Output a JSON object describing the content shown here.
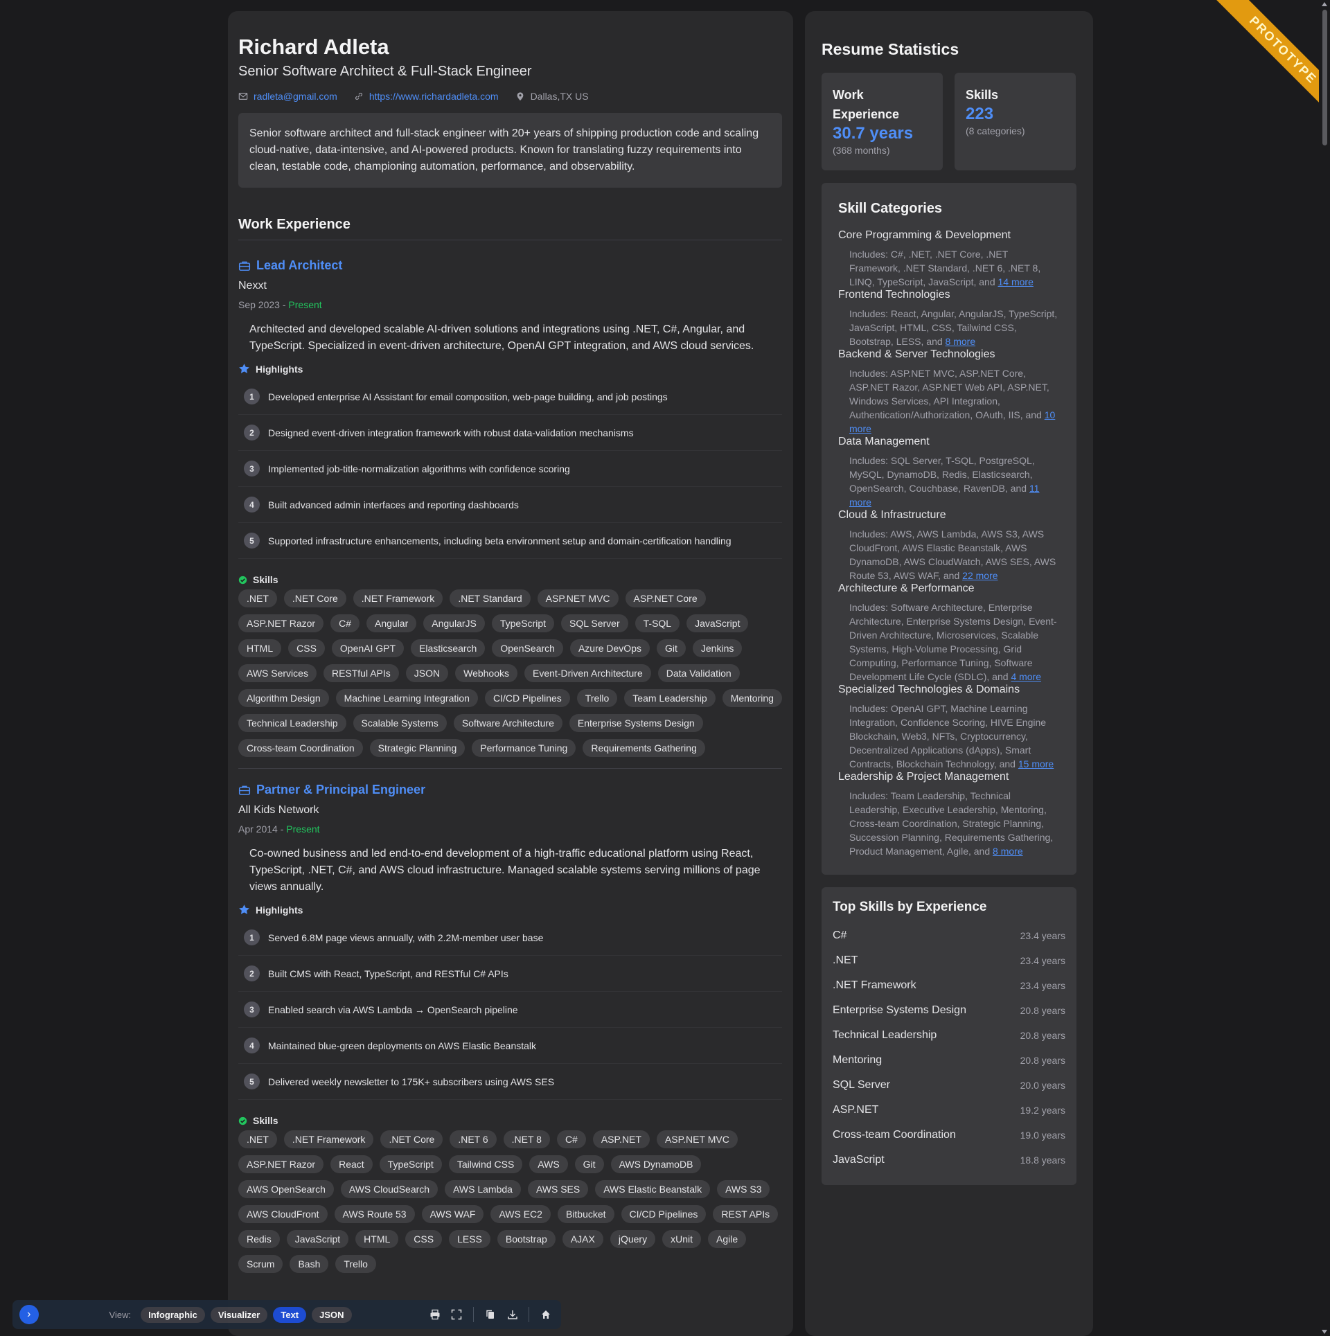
{
  "profile": {
    "name": "Richard Adleta",
    "title": "Senior Software Architect & Full-Stack Engineer",
    "email": "radleta@gmail.com",
    "website": "https://www.richardadleta.com",
    "location": "Dallas,TX  US",
    "summary": "Senior software architect and full-stack engineer with 20+ years of shipping production code and scaling cloud-native, data-intensive, and AI-powered products. Known for translating fuzzy requirements into clean, testable code, championing automation, performance, and observability."
  },
  "work": {
    "heading": "Work Experience",
    "highlights_label": "Highlights",
    "skills_label": "Skills",
    "jobs": [
      {
        "title": "Lead Architect",
        "company": "Nexxt",
        "start": "Sep 2023",
        "sep": " - ",
        "end": "Present",
        "description": "Architected and developed scalable AI-driven solutions and integrations using .NET, C#, Angular, and TypeScript. Specialized in event-driven architecture, OpenAI GPT integration, and AWS cloud services.",
        "highlights": [
          "Developed enterprise AI Assistant for email composition, web-page building, and job postings",
          "Designed event-driven integration framework with robust data-validation mechanisms",
          "Implemented job-title-normalization algorithms with confidence scoring",
          "Built advanced admin interfaces and reporting dashboards",
          "Supported infrastructure enhancements, including beta environment setup and domain-certification handling"
        ],
        "skills": [
          ".NET",
          ".NET Core",
          ".NET Framework",
          ".NET Standard",
          "ASP.NET MVC",
          "ASP.NET Core",
          "ASP.NET Razor",
          "C#",
          "Angular",
          "AngularJS",
          "TypeScript",
          "SQL Server",
          "T-SQL",
          "JavaScript",
          "HTML",
          "CSS",
          "OpenAI GPT",
          "Elasticsearch",
          "OpenSearch",
          "Azure DevOps",
          "Git",
          "Jenkins",
          "AWS Services",
          "RESTful APIs",
          "JSON",
          "Webhooks",
          "Event-Driven Architecture",
          "Data Validation",
          "Algorithm Design",
          "Machine Learning Integration",
          "CI/CD Pipelines",
          "Trello",
          "Team Leadership",
          "Mentoring",
          "Technical Leadership",
          "Scalable Systems",
          "Software Architecture",
          "Enterprise Systems Design",
          "Cross-team Coordination",
          "Strategic Planning",
          "Performance Tuning",
          "Requirements Gathering"
        ]
      },
      {
        "title": "Partner & Principal Engineer",
        "company": "All Kids Network",
        "start": "Apr 2014",
        "sep": " - ",
        "end": "Present",
        "description": "Co-owned business and led end-to-end development of a high-traffic educational platform using React, TypeScript, .NET, C#, and AWS cloud infrastructure. Managed scalable systems serving millions of page views annually.",
        "highlights": [
          "Served 6.8M page views annually, with 2.2M-member user base",
          "Built CMS with React, TypeScript, and RESTful C# APIs",
          "Enabled search via AWS Lambda → OpenSearch pipeline",
          "Maintained blue-green deployments on AWS Elastic Beanstalk",
          "Delivered weekly newsletter to 175K+ subscribers using AWS SES"
        ],
        "skills": [
          ".NET",
          ".NET Framework",
          ".NET Core",
          ".NET 6",
          ".NET 8",
          "C#",
          "ASP.NET",
          "ASP.NET MVC",
          "ASP.NET Razor",
          "React",
          "TypeScript",
          "Tailwind CSS",
          "AWS",
          "Git",
          "AWS DynamoDB",
          "AWS OpenSearch",
          "AWS CloudSearch",
          "AWS Lambda",
          "AWS SES",
          "AWS Elastic Beanstalk",
          "AWS S3",
          "AWS CloudFront",
          "AWS Route 53",
          "AWS WAF",
          "AWS EC2",
          "Bitbucket",
          "CI/CD Pipelines",
          "REST APIs",
          "Redis",
          "JavaScript",
          "HTML",
          "CSS",
          "LESS",
          "Bootstrap",
          "AJAX",
          "jQuery",
          "xUnit",
          "Agile",
          "Scrum",
          "Bash",
          "Trello"
        ]
      }
    ]
  },
  "stats": {
    "heading": "Resume Statistics",
    "work_label": "Work Experience",
    "work_value": "30.7 years",
    "work_note": "(368 months)",
    "skills_label": "Skills",
    "skills_value": "223",
    "skills_note": "(8 categories)"
  },
  "categories": {
    "heading": "Skill Categories",
    "items": [
      {
        "name": "Core Programming & Development",
        "includes": "Includes: C#, .NET, .NET Core, .NET Framework, .NET Standard, .NET 6, .NET 8, LINQ, TypeScript, JavaScript, and ",
        "more": "14 more"
      },
      {
        "name": "Frontend Technologies",
        "includes": "Includes: React, Angular, AngularJS, TypeScript, JavaScript, HTML, CSS, Tailwind CSS, Bootstrap, LESS, and ",
        "more": "8 more"
      },
      {
        "name": "Backend & Server Technologies",
        "includes": "Includes: ASP.NET MVC, ASP.NET Core, ASP.NET Razor, ASP.NET Web API, ASP.NET, Windows Services, API Integration, Authentication/Authorization, OAuth, IIS, and ",
        "more": "10 more"
      },
      {
        "name": "Data Management",
        "includes": "Includes: SQL Server, T-SQL, PostgreSQL, MySQL, DynamoDB, Redis, Elasticsearch, OpenSearch, Couchbase, RavenDB, and ",
        "more": "11 more"
      },
      {
        "name": "Cloud & Infrastructure",
        "includes": "Includes: AWS, AWS Lambda, AWS S3, AWS CloudFront, AWS Elastic Beanstalk, AWS DynamoDB, AWS CloudWatch, AWS SES, AWS Route 53, AWS WAF, and ",
        "more": "22 more"
      },
      {
        "name": "Architecture & Performance",
        "includes": "Includes: Software Architecture, Enterprise Architecture, Enterprise Systems Design, Event-Driven Architecture, Microservices, Scalable Systems, High-Volume Processing, Grid Computing, Performance Tuning, Software Development Life Cycle (SDLC), and ",
        "more": "4 more"
      },
      {
        "name": "Specialized Technologies & Domains",
        "includes": "Includes: OpenAI GPT, Machine Learning Integration, Confidence Scoring, HIVE Engine Blockchain, Web3, NFTs, Cryptocurrency, Decentralized Applications (dApps), Smart Contracts, Blockchain Technology, and ",
        "more": "15 more"
      },
      {
        "name": "Leadership & Project Management",
        "includes": "Includes: Team Leadership, Technical Leadership, Executive Leadership, Mentoring, Cross-team Coordination, Strategic Planning, Succession Planning, Requirements Gathering, Product Management, Agile, and ",
        "more": "8 more"
      }
    ]
  },
  "top_skills": {
    "heading": "Top Skills by Experience",
    "items": [
      {
        "name": "C#",
        "years": "23.4 years"
      },
      {
        "name": ".NET",
        "years": "23.4 years"
      },
      {
        "name": ".NET Framework",
        "years": "23.4 years"
      },
      {
        "name": "Enterprise Systems Design",
        "years": "20.8 years"
      },
      {
        "name": "Technical Leadership",
        "years": "20.8 years"
      },
      {
        "name": "Mentoring",
        "years": "20.8 years"
      },
      {
        "name": "SQL Server",
        "years": "20.0 years"
      },
      {
        "name": "ASP.NET",
        "years": "19.2 years"
      },
      {
        "name": "Cross-team Coordination",
        "years": "19.0 years"
      },
      {
        "name": "JavaScript",
        "years": "18.8 years"
      }
    ]
  },
  "ribbon": {
    "label": "PROTOTYPE"
  },
  "toolbar": {
    "view_label": "View:",
    "views": [
      "Infographic",
      "Visualizer",
      "Text",
      "JSON"
    ],
    "active_view": "Text",
    "icons": [
      "print-icon",
      "fullscreen-icon",
      "copy-icon",
      "download-icon",
      "home-icon"
    ]
  },
  "colors": {
    "accent": "#4f8ef7",
    "present": "#22c55e",
    "ribbon": "#e29a10",
    "background": "#1b1b1d",
    "card": "#2a2a2c"
  }
}
